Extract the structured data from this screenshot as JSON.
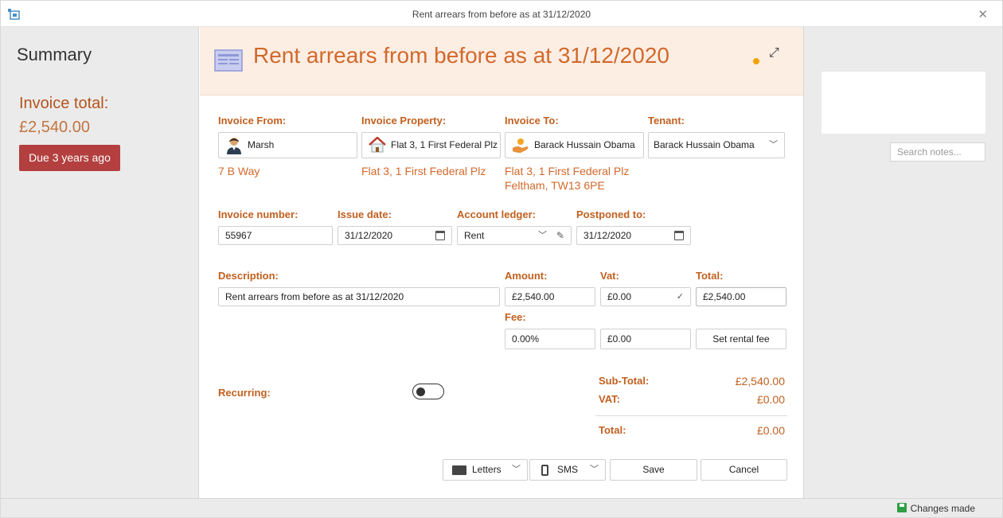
{
  "window": {
    "title": "Rent arrears from before as at 31/12/2020"
  },
  "summary": {
    "title": "Summary",
    "invoice_total_label": "Invoice total:",
    "invoice_total_value": "£2,540.00",
    "due_badge": "Due 3 years ago"
  },
  "header": {
    "title": "Rent arrears from before as at 31/12/2020",
    "status_color": "#f2a100"
  },
  "invoice_from": {
    "label": "Invoice From:",
    "value": "Marsh",
    "address": "7 B Way",
    "icon": "person-icon"
  },
  "invoice_property": {
    "label": "Invoice Property:",
    "value": "Flat 3, 1 First Federal Plz",
    "address": "Flat 3, 1 First Federal Plz",
    "icon": "house-icon"
  },
  "invoice_to": {
    "label": "Invoice To:",
    "value": "Barack Hussain Obama",
    "address_line1": "Flat 3, 1 First Federal Plz",
    "address_line2": "Feltham, TW13 6PE",
    "icon": "tenant-hand-icon"
  },
  "tenant": {
    "label": "Tenant:",
    "value": "Barack Hussain Obama"
  },
  "invoice_number": {
    "label": "Invoice number:",
    "value": "55967"
  },
  "issue_date": {
    "label": "Issue date:",
    "value": "31/12/2020"
  },
  "account_ledger": {
    "label": "Account ledger:",
    "value": "Rent"
  },
  "postponed_to": {
    "label": "Postponed to:",
    "value": "31/12/2020"
  },
  "description": {
    "label": "Description:",
    "value": "Rent arrears from before as at 31/12/2020"
  },
  "amount": {
    "label": "Amount:",
    "value": "£2,540.00"
  },
  "vat": {
    "label": "Vat:",
    "value": "£0.00"
  },
  "total": {
    "label": "Total:",
    "value": "£2,540.00"
  },
  "fee": {
    "label": "Fee:",
    "percent": "0.00%",
    "value": "£0.00",
    "set_button": "Set rental fee"
  },
  "recurring": {
    "label": "Recurring:",
    "enabled": false
  },
  "totals": {
    "subtotal_label": "Sub-Total:",
    "subtotal_value": "£2,540.00",
    "vat_label": "VAT:",
    "vat_value": "£0.00",
    "total_label": "Total:",
    "total_value": "£0.00"
  },
  "actions": {
    "letters": "Letters",
    "sms": "SMS",
    "save": "Save",
    "cancel": "Cancel"
  },
  "notes": {
    "search_placeholder": "Search notes..."
  },
  "status": {
    "text": "Changes made"
  },
  "colors": {
    "accent": "#d2692b",
    "label": "#c2601f",
    "badge": "#b33f3f",
    "header_bg": "#fdeee4"
  }
}
